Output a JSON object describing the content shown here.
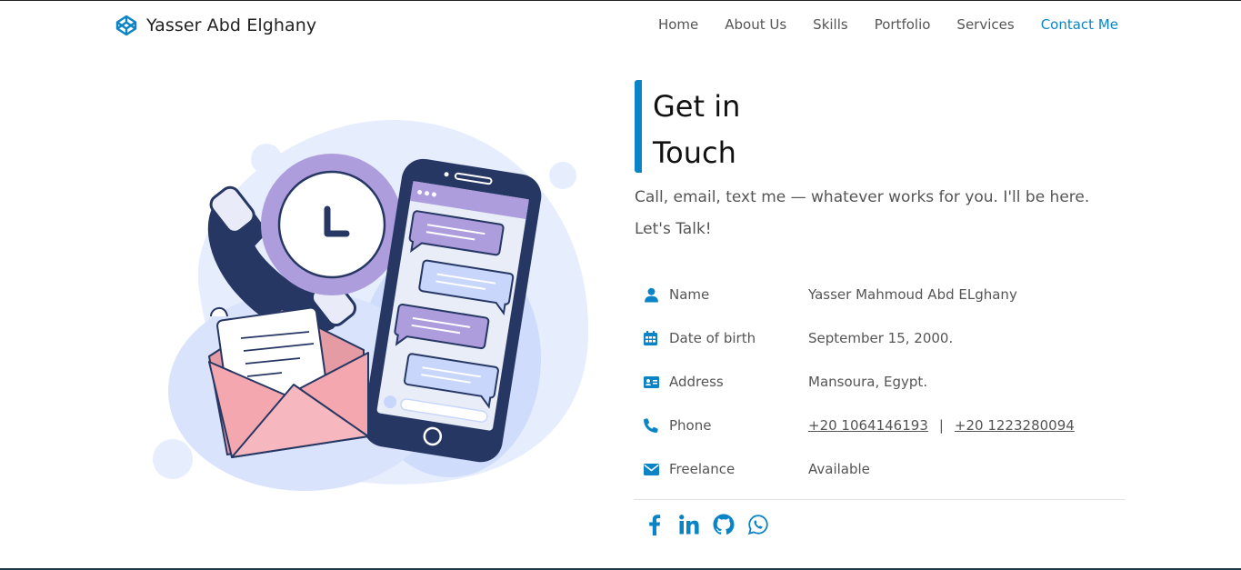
{
  "brand": {
    "name": "Yasser Abd Elghany",
    "icon": "codepen-icon"
  },
  "nav": {
    "items": [
      "Home",
      "About Us",
      "Skills",
      "Portfolio",
      "Services",
      "Contact Me"
    ],
    "active": "Contact Me"
  },
  "contact": {
    "heading_line1": "Get in",
    "heading_line2": "Touch",
    "lead": "Call, email, text me — whatever works for you. I'll be here. Let's Talk!",
    "rows": [
      {
        "icon": "user-icon",
        "label": "Name",
        "value": "Yasser Mahmoud Abd ELghany"
      },
      {
        "icon": "calendar-icon",
        "label": "Date of birth",
        "value": "September 15, 2000."
      },
      {
        "icon": "address-card-icon",
        "label": "Address",
        "value": "Mansoura, Egypt."
      },
      {
        "icon": "phone-icon",
        "label": "Phone",
        "phone1": "+20 1064146193",
        "separator": "|",
        "phone2": "+20 1223280094"
      },
      {
        "icon": "envelope-icon",
        "label": "Freelance",
        "value": "Available"
      }
    ],
    "social": [
      "facebook-icon",
      "linkedin-icon",
      "github-icon",
      "whatsapp-icon"
    ]
  },
  "colors": {
    "accent": "#0b84c6",
    "text": "#555555",
    "heading": "#111111",
    "illustration_navy": "#263763",
    "illustration_purple": "#ad9ddc",
    "illustration_pink": "#f4a7ae"
  }
}
